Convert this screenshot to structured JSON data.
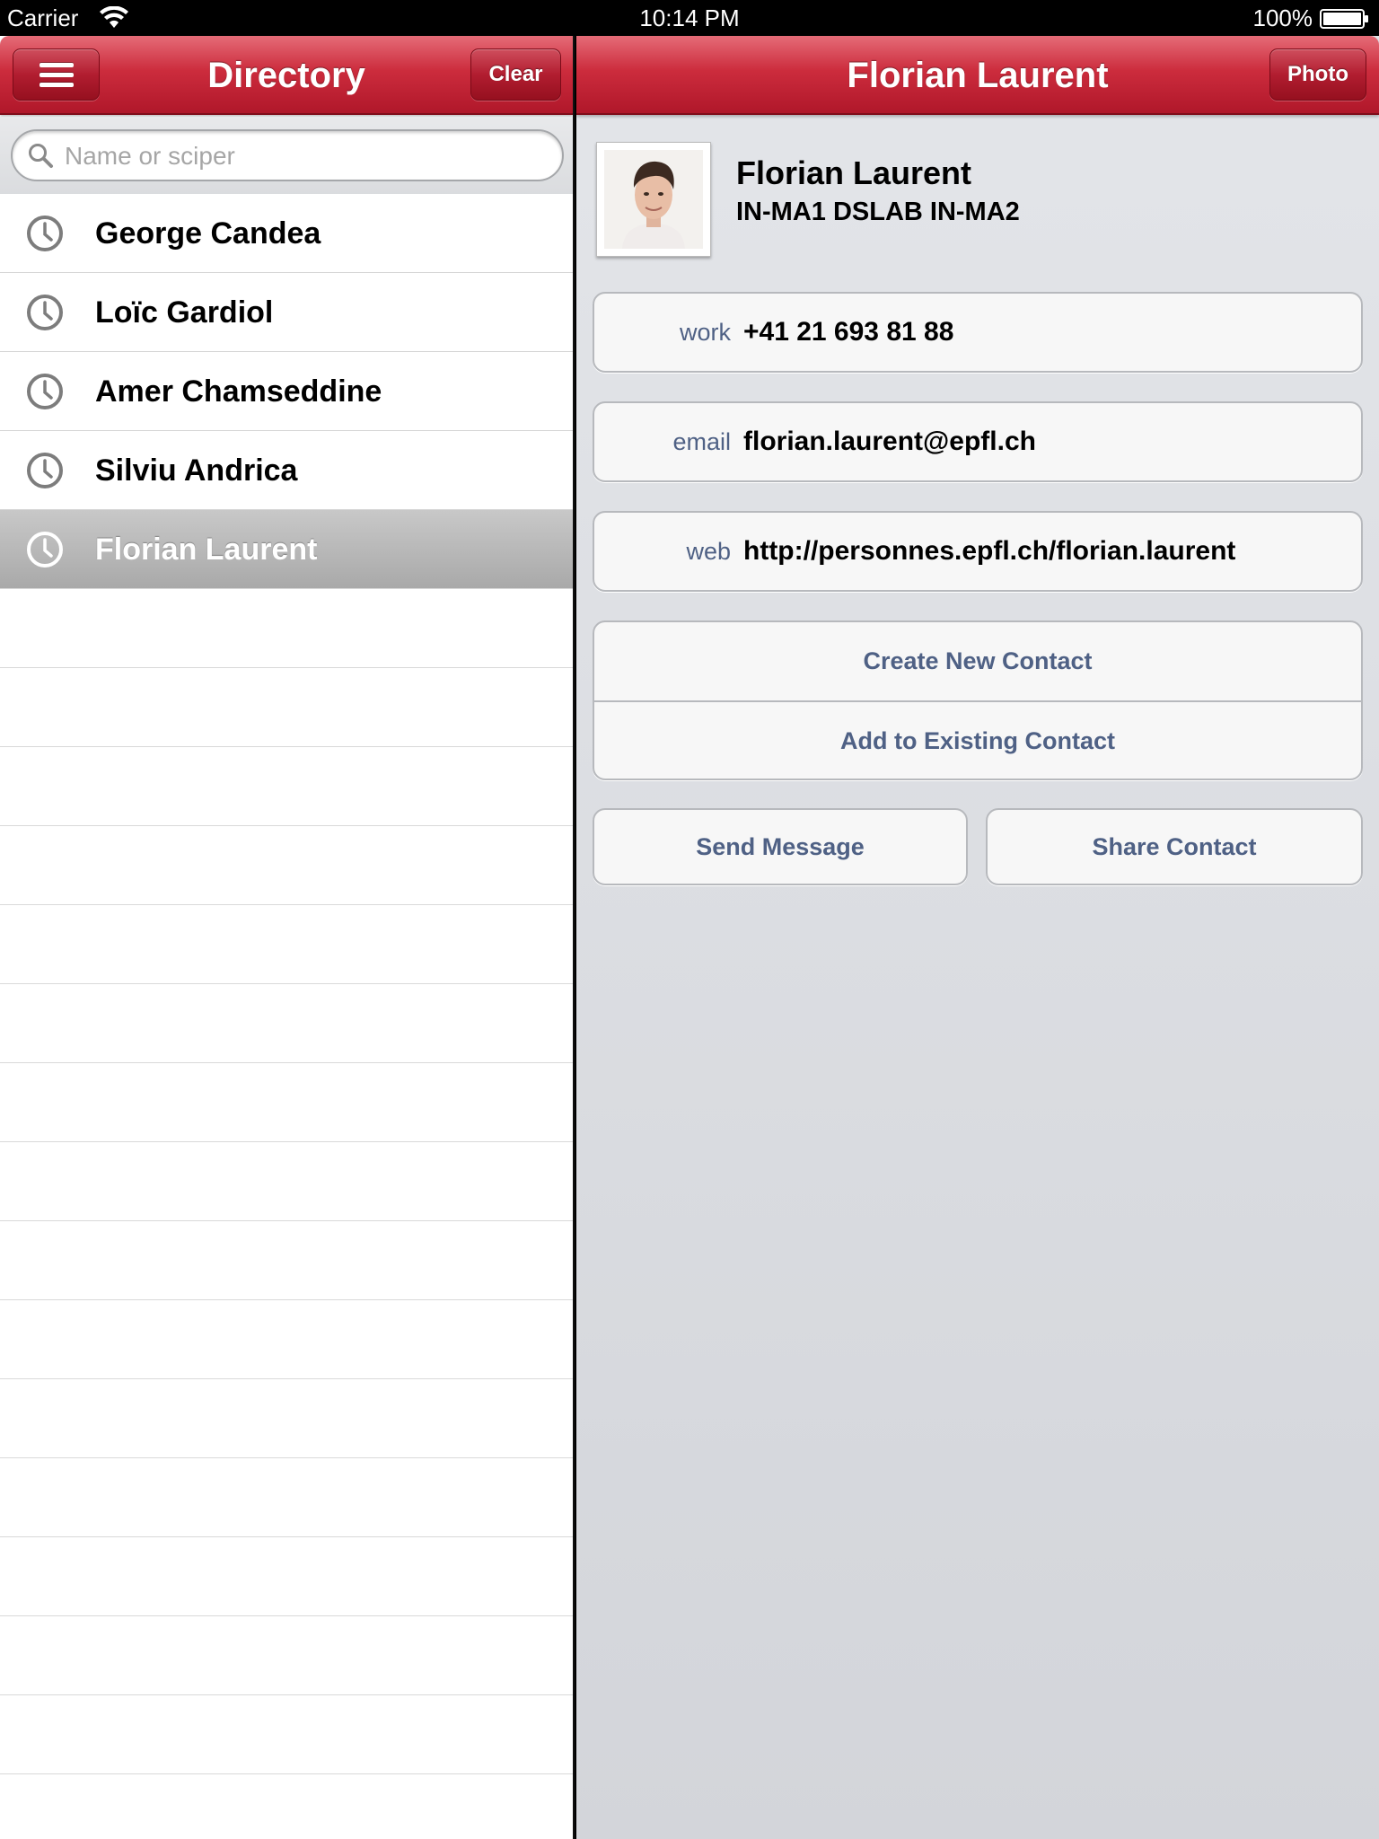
{
  "status_bar": {
    "carrier": "Carrier",
    "time": "10:14 PM",
    "battery": "100%"
  },
  "left_pane": {
    "title": "Directory",
    "clear_label": "Clear",
    "search": {
      "placeholder": "Name or sciper",
      "value": ""
    },
    "history": [
      {
        "name": "George Candea",
        "icon": "clock-icon",
        "selected": false
      },
      {
        "name": "Loïc Gardiol",
        "icon": "clock-icon",
        "selected": false
      },
      {
        "name": "Amer Chamseddine",
        "icon": "clock-icon",
        "selected": false
      },
      {
        "name": "Silviu Andrica",
        "icon": "clock-icon",
        "selected": false
      },
      {
        "name": "Florian Laurent",
        "icon": "clock-icon",
        "selected": true
      }
    ]
  },
  "detail": {
    "title": "Florian Laurent",
    "photo_label": "Photo",
    "person": {
      "name": "Florian Laurent",
      "units": "IN-MA1 DSLAB IN-MA2"
    },
    "fields": [
      {
        "label": "work",
        "value": "+41 21 693 81 88"
      },
      {
        "label": "email",
        "value": "florian.laurent@epfl.ch"
      },
      {
        "label": "web",
        "value": "http://personnes.epfl.ch/florian.laurent"
      }
    ],
    "actions": {
      "create_contact": "Create New Contact",
      "add_existing": "Add to Existing Contact",
      "send_message": "Send Message",
      "share_contact": "Share Contact"
    }
  },
  "colors": {
    "accent_red": "#c0202f",
    "link_blue": "#4f6185"
  }
}
